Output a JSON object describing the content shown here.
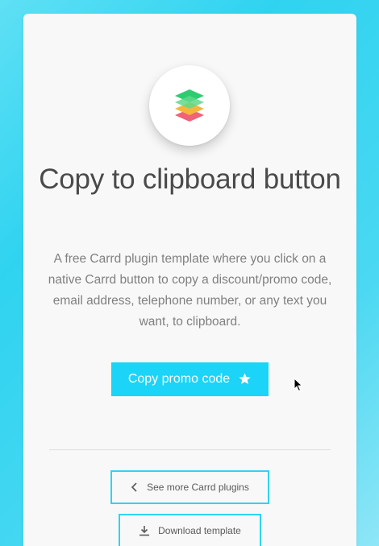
{
  "page": {
    "title": "Copy to clipboard button",
    "description": "A free Carrd plugin template where you click on a native Carrd button to copy a discount/promo code, email address, telephone number, or any text you want, to clipboard."
  },
  "logo": {
    "icon": "layers-icon",
    "colors": [
      "#2ecc71",
      "#f5b73b",
      "#f06277"
    ]
  },
  "buttons": {
    "copy_label": "Copy promo code",
    "copy_icon": "star-icon",
    "more_label": "See more Carrd plugins",
    "more_icon": "chevron-left-icon",
    "download_label": "Download template",
    "download_icon": "download-icon"
  },
  "colors": {
    "accent": "#1bd4f7",
    "card": "#f8f8f8",
    "title_text": "#4a4a4a",
    "body_text": "#808080"
  }
}
